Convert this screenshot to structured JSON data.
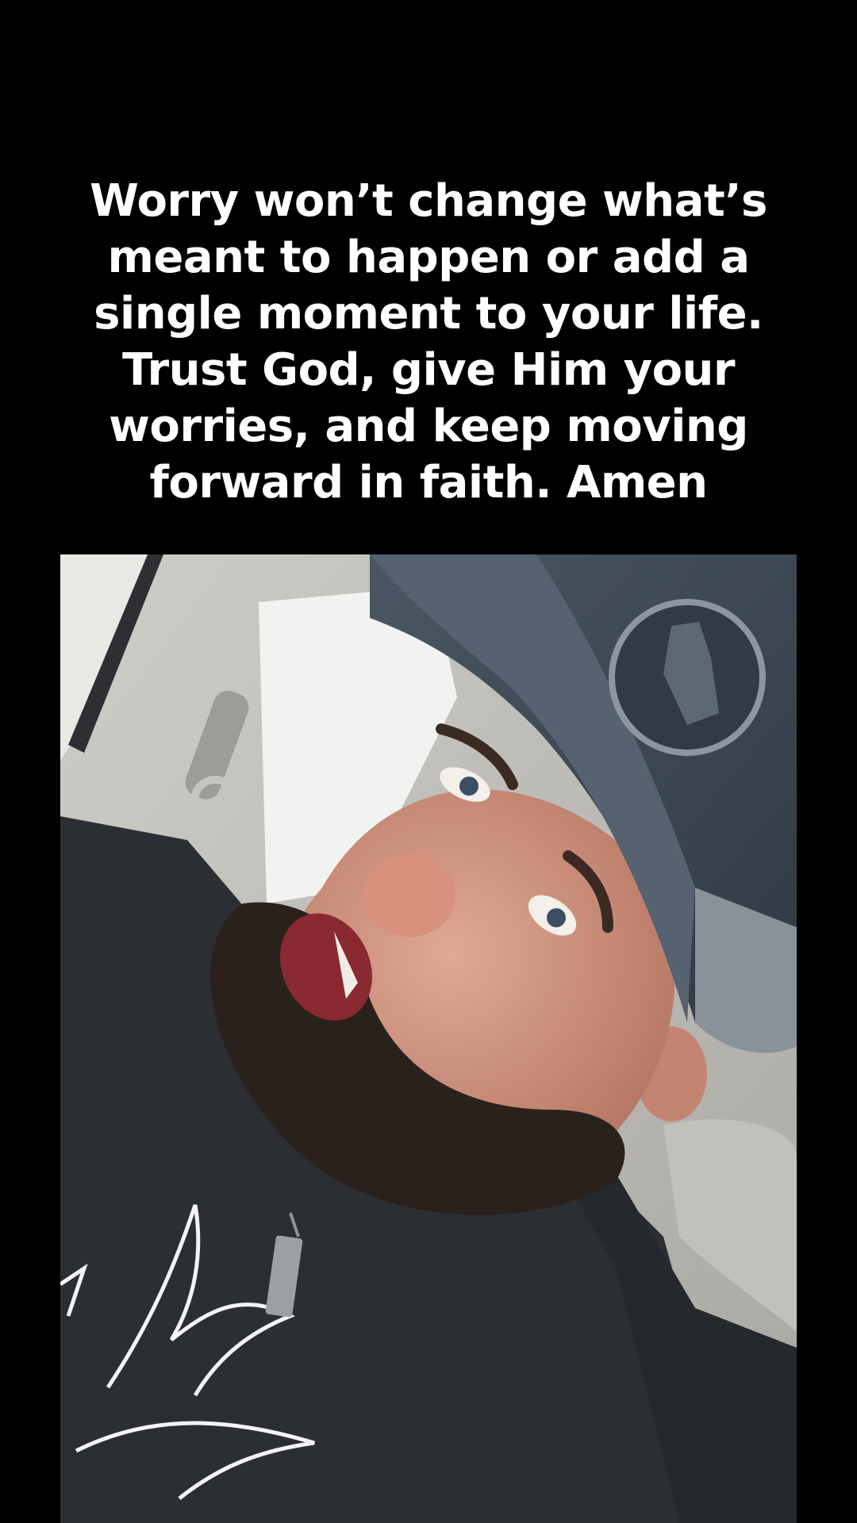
{
  "caption": {
    "lines": [
      "Worry won’t change what’s",
      "meant to happen or add a",
      "single moment to your life.",
      "Trust God, give Him your",
      "worries, and keep moving",
      "forward in faith. Amen"
    ]
  },
  "photo": {
    "subject": "man in cap speaking in car",
    "colors": {
      "background": "#000000",
      "car_interior": "#b9b7b1",
      "window_light": "#f2f3f1",
      "skin": "#c98c7a",
      "beard": "#2a211d",
      "cap": "#3e4a55",
      "shirt": "#2b2e32",
      "eagle_print": "#f4f4f4"
    }
  }
}
